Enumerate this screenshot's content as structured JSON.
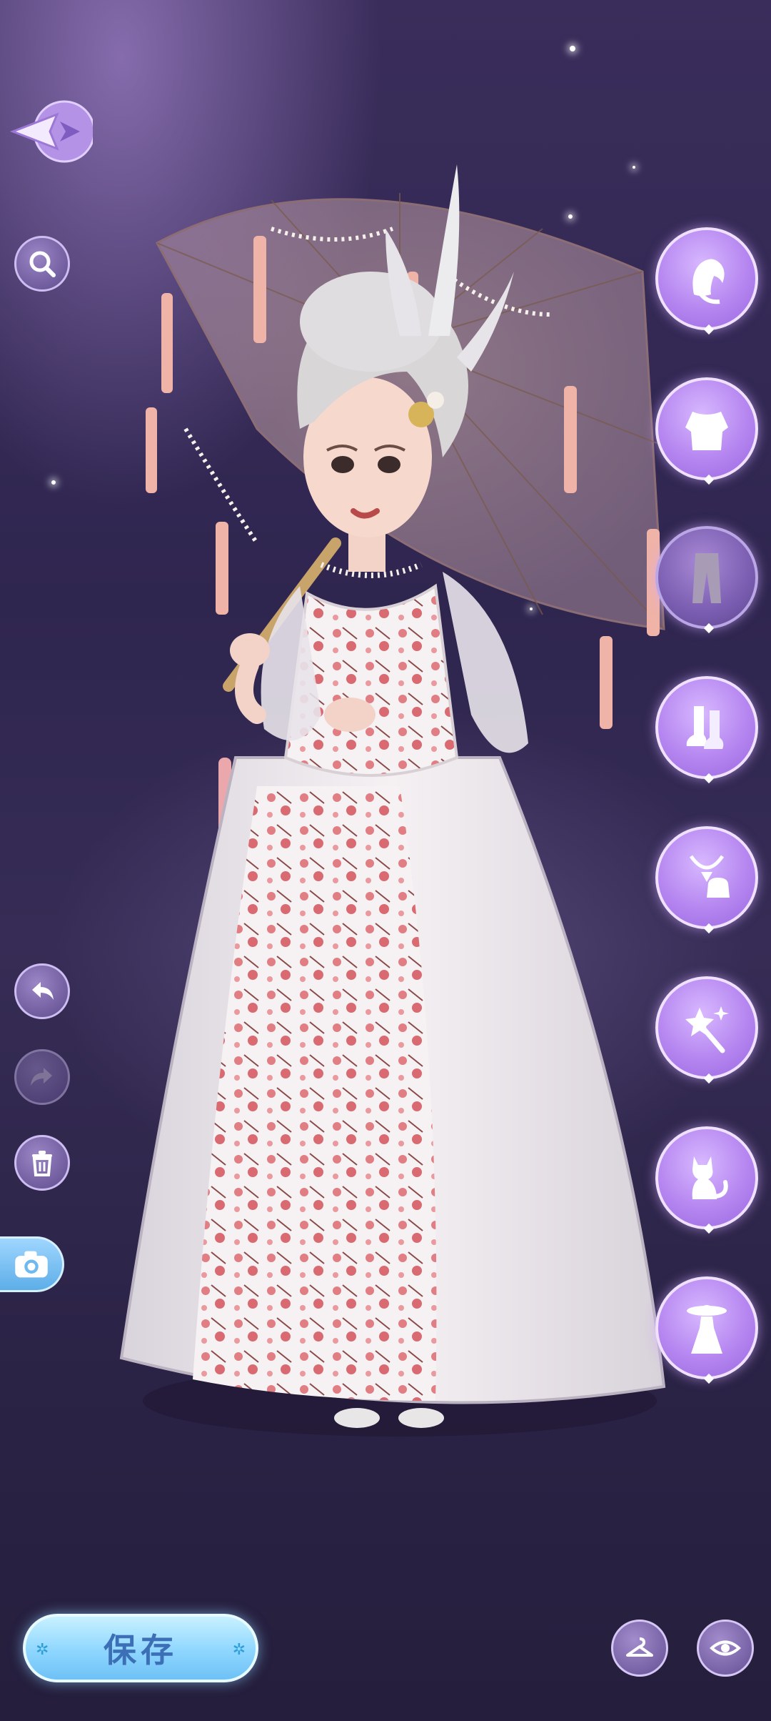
{
  "screen": "wardrobe-dress-up",
  "controls": {
    "back": "back-arrow-icon",
    "search": "search-icon",
    "undo": "undo-icon",
    "redo": "redo-icon",
    "delete": "trash-icon",
    "camera": "camera-icon"
  },
  "categories": [
    {
      "id": "hair",
      "icon": "hairstyle-icon",
      "selected": false
    },
    {
      "id": "top",
      "icon": "top-clothing-icon",
      "selected": false
    },
    {
      "id": "bottom",
      "icon": "pants-icon",
      "selected": true
    },
    {
      "id": "shoes",
      "icon": "shoes-icon",
      "selected": false
    },
    {
      "id": "accessories",
      "icon": "jewelry-bag-icon",
      "selected": false
    },
    {
      "id": "effects",
      "icon": "magic-wand-icon",
      "selected": false
    },
    {
      "id": "pet",
      "icon": "cat-icon",
      "selected": false
    },
    {
      "id": "outfit",
      "icon": "full-outfit-icon",
      "selected": false
    }
  ],
  "footer": {
    "save_label": "保存",
    "hanger": "hanger-icon",
    "preview": "eye-icon"
  },
  "colors": {
    "save_button": "#8ed6ff",
    "category_button": "#b586f0",
    "background": "#2f2650"
  }
}
